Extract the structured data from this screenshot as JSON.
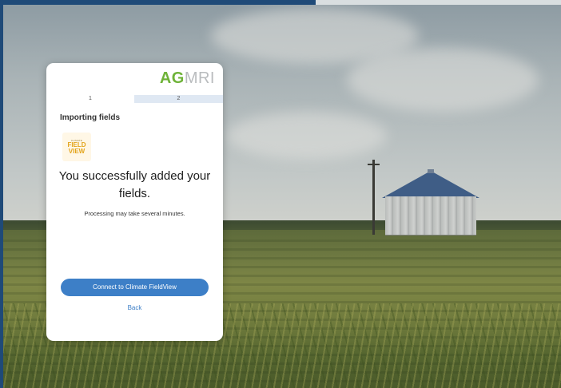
{
  "logo": {
    "part1": "AG",
    "part2": "MRI"
  },
  "stepper": {
    "steps": [
      "1",
      "2"
    ],
    "active_step": 2
  },
  "heading": "Importing fields",
  "fieldview_logo": {
    "line1": "CLIMATE",
    "line2": "FIELD",
    "line3": "VIEW"
  },
  "message": "You successfully added your fields.",
  "subtext": "Processing may take several minutes.",
  "buttons": {
    "connect": "Connect to Climate FieldView",
    "back": "Back"
  },
  "colors": {
    "brand_green": "#6fb339",
    "accent_blue": "#3d7fc7",
    "frame_blue": "#1f4a78"
  }
}
